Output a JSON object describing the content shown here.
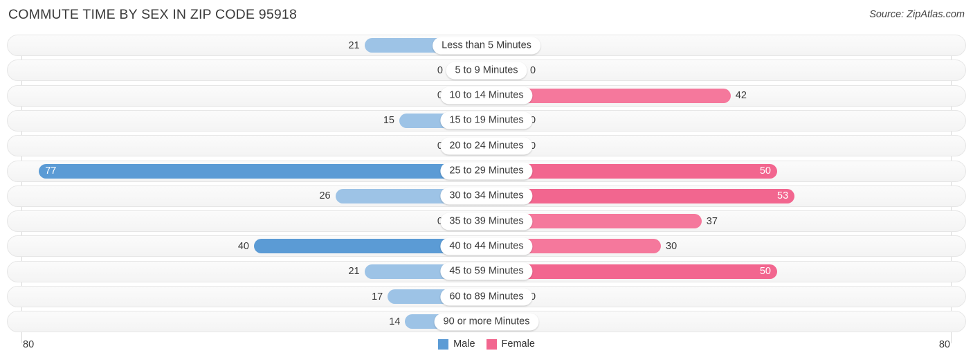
{
  "header": {
    "title": "COMMUTE TIME BY SEX IN ZIP CODE 95918",
    "source": "Source: ZipAtlas.com"
  },
  "axis": {
    "left_max_label": "80",
    "right_max_label": "80"
  },
  "legend": {
    "items": [
      {
        "label": "Male",
        "color": "#5b9bd5"
      },
      {
        "label": "Female",
        "color": "#f2668f"
      }
    ]
  },
  "chart_data": {
    "type": "bar",
    "subtype": "diverging-butterfly",
    "title": "COMMUTE TIME BY SEX IN ZIP CODE 95918",
    "xlabel": "",
    "ylabel": "",
    "xlim": [
      80,
      80
    ],
    "grid": false,
    "legend_position": "bottom-center",
    "categories": [
      "Less than 5 Minutes",
      "5 to 9 Minutes",
      "10 to 14 Minutes",
      "15 to 19 Minutes",
      "20 to 24 Minutes",
      "25 to 29 Minutes",
      "30 to 34 Minutes",
      "35 to 39 Minutes",
      "40 to 44 Minutes",
      "45 to 59 Minutes",
      "60 to 89 Minutes",
      "90 or more Minutes"
    ],
    "series": [
      {
        "name": "Male",
        "direction": "left",
        "values": [
          21,
          0,
          0,
          15,
          0,
          77,
          26,
          0,
          40,
          21,
          17,
          14
        ]
      },
      {
        "name": "Female",
        "direction": "right",
        "values": [
          0,
          0,
          42,
          0,
          0,
          50,
          53,
          37,
          30,
          50,
          0,
          0
        ]
      }
    ]
  },
  "rows": [
    {
      "category": "Less than 5 Minutes",
      "male": "21",
      "female": "0"
    },
    {
      "category": "5 to 9 Minutes",
      "male": "0",
      "female": "0"
    },
    {
      "category": "10 to 14 Minutes",
      "male": "0",
      "female": "42"
    },
    {
      "category": "15 to 19 Minutes",
      "male": "15",
      "female": "0"
    },
    {
      "category": "20 to 24 Minutes",
      "male": "0",
      "female": "0"
    },
    {
      "category": "25 to 29 Minutes",
      "male": "77",
      "female": "50"
    },
    {
      "category": "30 to 34 Minutes",
      "male": "26",
      "female": "53"
    },
    {
      "category": "35 to 39 Minutes",
      "male": "0",
      "female": "37"
    },
    {
      "category": "40 to 44 Minutes",
      "male": "40",
      "female": "30"
    },
    {
      "category": "45 to 59 Minutes",
      "male": "21",
      "female": "50"
    },
    {
      "category": "60 to 89 Minutes",
      "male": "17",
      "female": "0"
    },
    {
      "category": "90 or more Minutes",
      "male": "14",
      "female": "0"
    }
  ]
}
